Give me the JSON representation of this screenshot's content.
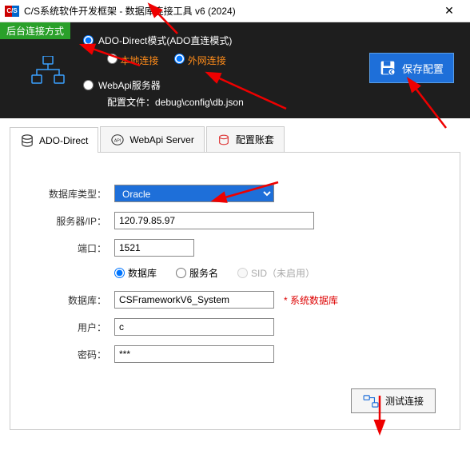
{
  "window": {
    "app_icon_text": "C/S",
    "title": "C/S系统软件开发框架 - 数据库连接工具 v6 (2024)"
  },
  "header": {
    "badge": "后台连接方式",
    "mode_ado_direct": "ADO-Direct模式(ADO直连模式)",
    "conn_local": "本地连接",
    "conn_external": "外网连接",
    "mode_webapi": "WebApi服务器",
    "config_file_label": "配置文件：",
    "config_file_path": "debug\\config\\db.json",
    "save_btn": "保存配置"
  },
  "tabs": {
    "ado": "ADO-Direct",
    "webapi": "WebApi Server",
    "account": "配置账套"
  },
  "form": {
    "dbtype_label": "数据库类型：",
    "dbtype_value": "Oracle",
    "server_label": "服务器/IP：",
    "server_value": "120.79.85.97",
    "port_label": "端口：",
    "port_value": "1521",
    "radio_db": "数据库",
    "radio_service": "服务名",
    "radio_sid": "SID（未启用）",
    "db_label": "数据库：",
    "db_value": "CSFrameworkV6_System",
    "db_hint": "* 系统数据库",
    "user_label": "用户：",
    "user_value": "c",
    "pwd_label": "密码：",
    "pwd_value": "***",
    "test_btn": "测试连接"
  }
}
